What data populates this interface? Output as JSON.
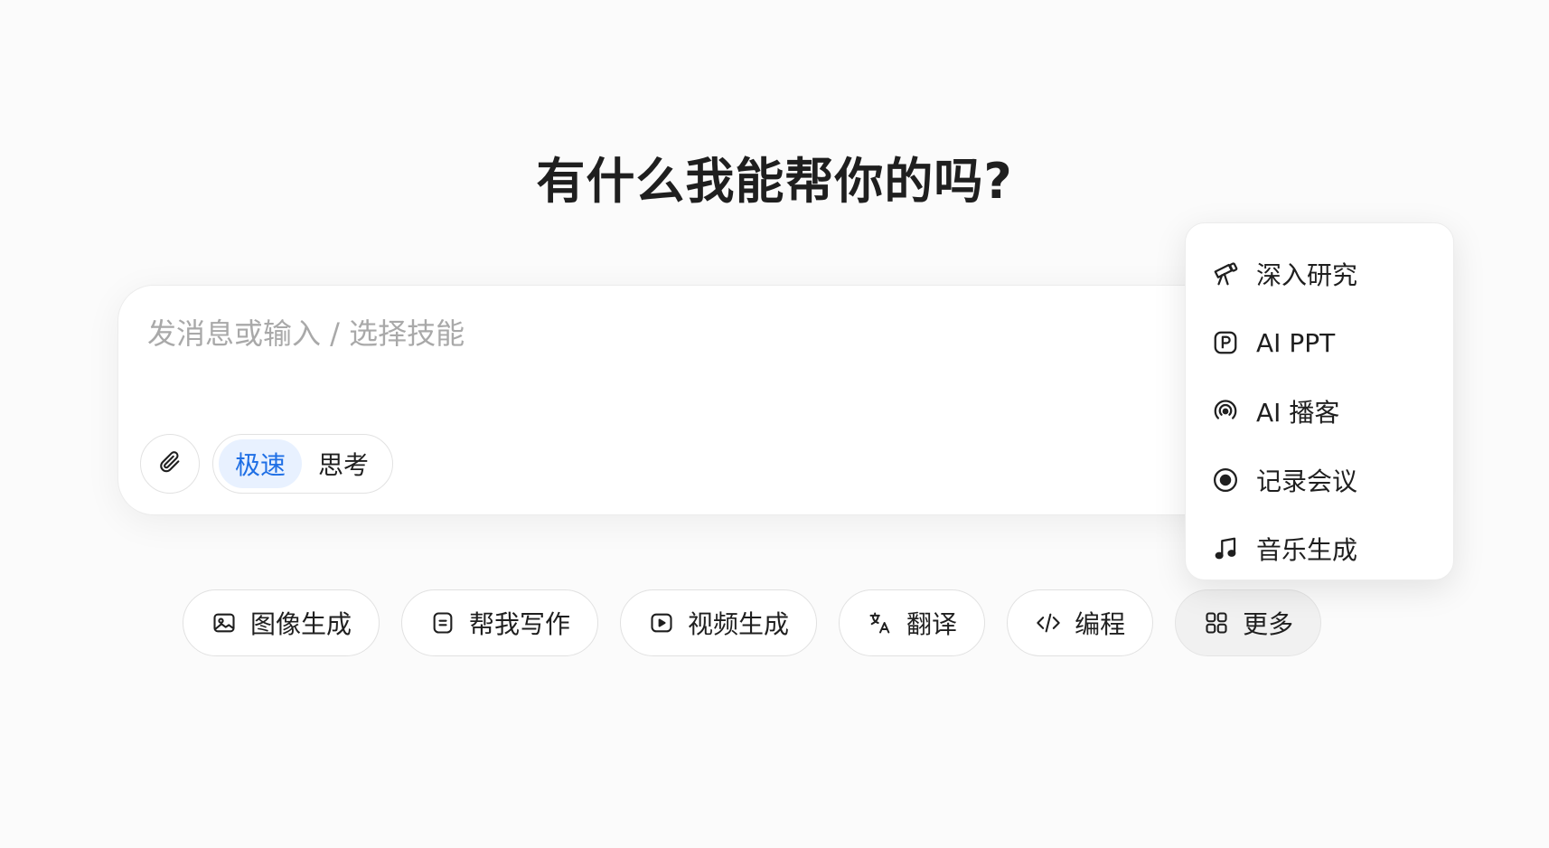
{
  "headline": "有什么我能帮你的吗?",
  "composer": {
    "placeholder": "发消息或输入 / 选择技能",
    "attach_icon": "paperclip-icon",
    "modes": [
      {
        "label": "极速",
        "active": true
      },
      {
        "label": "思考",
        "active": false
      }
    ]
  },
  "skills": [
    {
      "label": "图像生成",
      "icon": "image-icon"
    },
    {
      "label": "帮我写作",
      "icon": "document-icon"
    },
    {
      "label": "视频生成",
      "icon": "video-play-icon"
    },
    {
      "label": "翻译",
      "icon": "translate-icon"
    },
    {
      "label": "编程",
      "icon": "code-icon"
    },
    {
      "label": "更多",
      "icon": "grid-icon"
    }
  ],
  "more_menu": [
    {
      "label": "深入研究",
      "icon": "telescope-icon"
    },
    {
      "label": "AI PPT",
      "icon": "ppt-icon"
    },
    {
      "label": "AI 播客",
      "icon": "podcast-icon"
    },
    {
      "label": "记录会议",
      "icon": "record-icon"
    },
    {
      "label": "音乐生成",
      "icon": "music-note-icon"
    }
  ],
  "colors": {
    "background": "#fbfbfb",
    "accent": "#1f6fe5",
    "accent_bg": "#e8f1ff",
    "text": "#1f1f1f",
    "placeholder": "#a9a9a9"
  }
}
